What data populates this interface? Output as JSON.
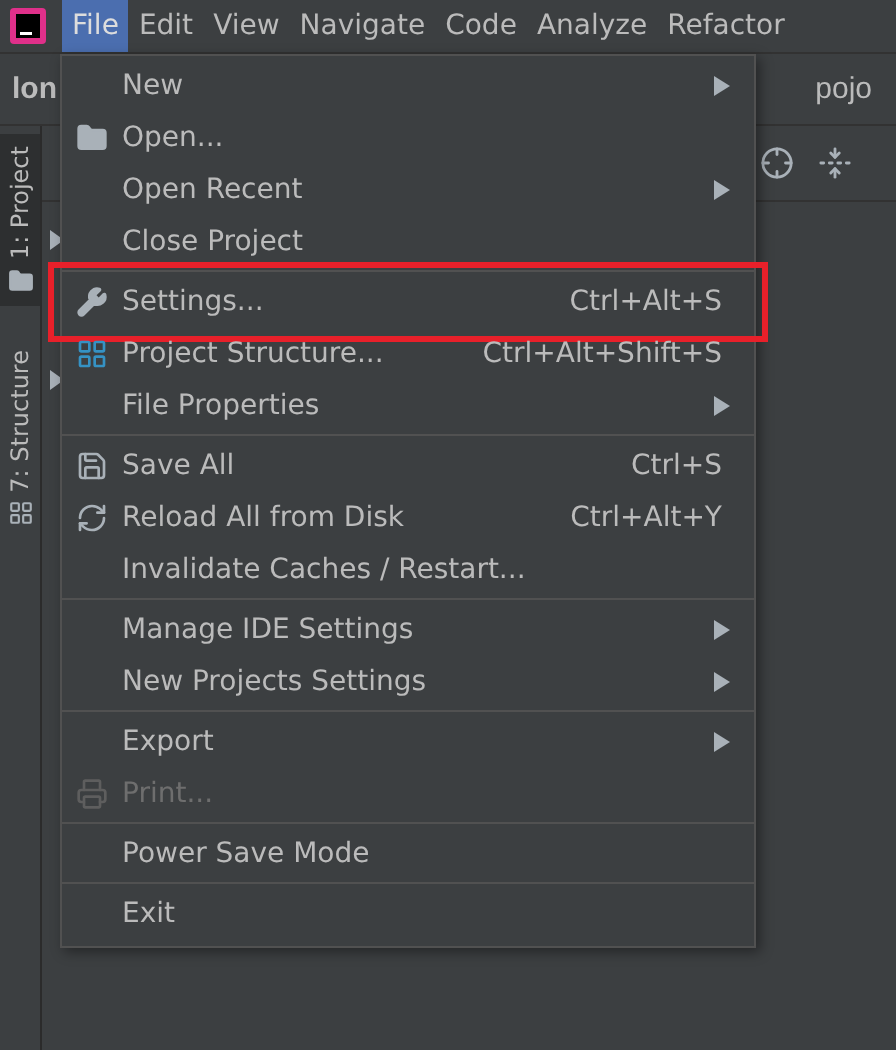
{
  "menubar": [
    {
      "label": "File",
      "selected": true
    },
    {
      "label": "Edit",
      "selected": false
    },
    {
      "label": "View",
      "selected": false
    },
    {
      "label": "Navigate",
      "selected": false
    },
    {
      "label": "Code",
      "selected": false
    },
    {
      "label": "Analyze",
      "selected": false
    },
    {
      "label": "Refactor",
      "selected": false
    }
  ],
  "breadcrumb": [
    "lon",
    "pojo"
  ],
  "tool_window_tabs": [
    {
      "label": "1: Project",
      "selected": true,
      "kind": "folder"
    },
    {
      "label": "7: Structure",
      "selected": false,
      "kind": "structure"
    }
  ],
  "file_menu": {
    "groups": [
      [
        {
          "label": "New",
          "submenu": true,
          "disabled": false,
          "highlighted": false
        },
        {
          "label": "Open...",
          "kind": "folder",
          "submenu": false,
          "disabled": false,
          "highlighted": false
        },
        {
          "label": "Open Recent",
          "submenu": true,
          "disabled": false,
          "highlighted": false
        },
        {
          "label": "Close Project",
          "submenu": false,
          "disabled": false,
          "highlighted": false
        }
      ],
      [
        {
          "label": "Settings...",
          "shortcut": "Ctrl+Alt+S",
          "kind": "wrench",
          "submenu": false,
          "disabled": false,
          "highlighted": true
        },
        {
          "label": "Project Structure...",
          "shortcut": "Ctrl+Alt+Shift+S",
          "kind": "structure",
          "submenu": false,
          "disabled": false,
          "highlighted": false
        },
        {
          "label": "File Properties",
          "submenu": true,
          "disabled": false,
          "highlighted": false
        }
      ],
      [
        {
          "label": "Save All",
          "shortcut": "Ctrl+S",
          "kind": "save",
          "submenu": false,
          "disabled": false,
          "highlighted": false
        },
        {
          "label": "Reload All from Disk",
          "shortcut": "Ctrl+Alt+Y",
          "kind": "reload",
          "submenu": false,
          "disabled": false,
          "highlighted": false
        },
        {
          "label": "Invalidate Caches / Restart...",
          "submenu": false,
          "disabled": false,
          "highlighted": false
        }
      ],
      [
        {
          "label": "Manage IDE Settings",
          "submenu": true,
          "disabled": false,
          "highlighted": false
        },
        {
          "label": "New Projects Settings",
          "submenu": true,
          "disabled": false,
          "highlighted": false
        }
      ],
      [
        {
          "label": "Export",
          "submenu": true,
          "disabled": false,
          "highlighted": false
        },
        {
          "label": "Print...",
          "kind": "print",
          "submenu": false,
          "disabled": true,
          "highlighted": false
        }
      ],
      [
        {
          "label": "Power Save Mode",
          "submenu": false,
          "disabled": false,
          "highlighted": false
        }
      ],
      [
        {
          "label": "Exit",
          "submenu": false,
          "disabled": false,
          "highlighted": false
        }
      ]
    ]
  }
}
